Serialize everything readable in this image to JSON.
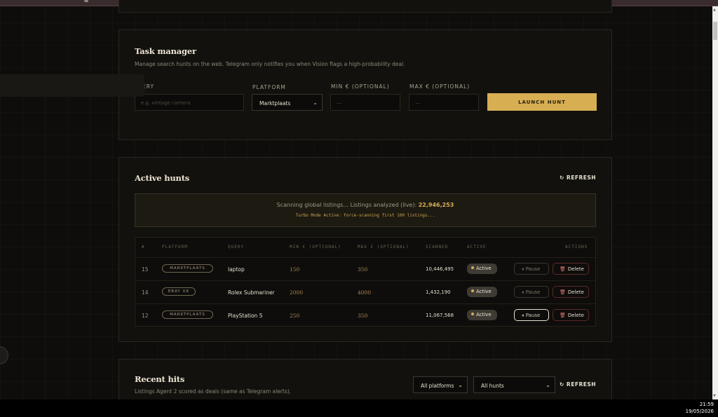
{
  "task_manager": {
    "title": "Task manager",
    "subtitle": "Manage search hunts on the web. Telegram only notifies you when Vision flags a high-probability deal.",
    "query_label": "ERY",
    "query_placeholder": "e.g. vintage camera",
    "platform_label": "PLATFORM",
    "platform_value": "Marktplaats",
    "min_label": "MIN € (OPTIONAL)",
    "min_placeholder": "—",
    "max_label": "MAX € (OPTIONAL)",
    "max_placeholder": "—",
    "launch_label": "LAUNCH HUNT"
  },
  "active_hunts": {
    "title": "Active hunts",
    "refresh_label": "REFRESH",
    "scanning_text": "Scanning global listings... Listings analyzed (live):",
    "listings_analyzed": "22,946,253",
    "turbo_text": "Turbo Mode Active: Force-scanning first 100 listings...",
    "columns": [
      "#",
      "PLATFORM",
      "QUERY",
      "MIN € (OPTIONAL)",
      "MAX € (OPTIONAL)",
      "SCANNED",
      "ACTIVE",
      "ACTIONS"
    ],
    "rows": [
      {
        "id": "15",
        "platform": "MARKTPLAATS",
        "query": "laptop",
        "min": "150",
        "max": "350",
        "scanned": "10,446,495",
        "active": "Active",
        "pause": "Pause",
        "delete": "Delete"
      },
      {
        "id": "14",
        "platform": "EBAY UK",
        "query": "Rolex Submariner",
        "min": "2000",
        "max": "4000",
        "scanned": "1,432,190",
        "active": "Active",
        "pause": "Pause",
        "delete": "Delete"
      },
      {
        "id": "12",
        "platform": "MARKTPLAATS",
        "query": "PlayStation 5",
        "min": "250",
        "max": "350",
        "scanned": "11,067,568",
        "active": "Active",
        "pause": "Pause",
        "delete": "Delete"
      }
    ]
  },
  "recent_hits": {
    "title": "Recent hits",
    "subtitle": "Listings Agent 2 scored as deals (same as Telegram alerts).",
    "platform_filter": "All platforms",
    "hunt_filter": "All hunts",
    "refresh_label": "REFRESH"
  },
  "taskbar": {
    "time": "21:59",
    "date": "19/05/2026"
  },
  "colors": {
    "accent": "#d8ae53",
    "background": "#0d0c0a",
    "danger": "#e07a6c"
  }
}
